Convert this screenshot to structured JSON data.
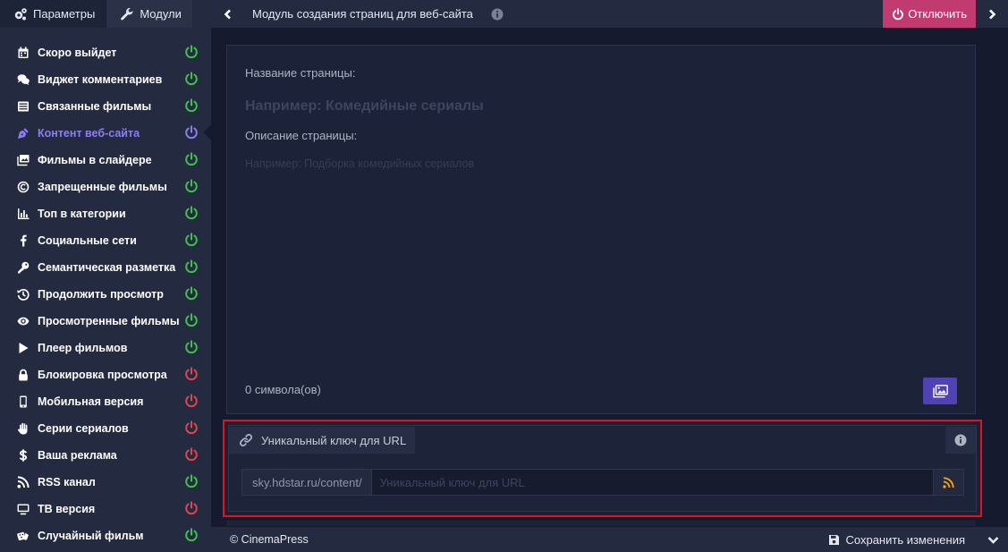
{
  "sidebar": {
    "tabs": [
      {
        "label": "Параметры",
        "icon": "gears-icon"
      },
      {
        "label": "Модули",
        "icon": "wrench-icon"
      }
    ],
    "items": [
      {
        "label": "Скоро выйдет",
        "icon": "calendar-icon",
        "status": "on"
      },
      {
        "label": "Виджет комментариев",
        "icon": "comments-icon",
        "status": "on"
      },
      {
        "label": "Связанные фильмы",
        "icon": "list-icon",
        "status": "on"
      },
      {
        "label": "Контент веб-сайта",
        "icon": "pen-nib-icon",
        "status": "active"
      },
      {
        "label": "Фильмы в слайдере",
        "icon": "images-icon",
        "status": "on"
      },
      {
        "label": "Запрещенные фильмы",
        "icon": "copyright-icon",
        "status": "on"
      },
      {
        "label": "Топ в категории",
        "icon": "chart-bar-icon",
        "status": "on"
      },
      {
        "label": "Социальные сети",
        "icon": "facebook-icon",
        "status": "on"
      },
      {
        "label": "Семантическая разметка",
        "icon": "key-icon",
        "status": "on"
      },
      {
        "label": "Продолжить просмотр",
        "icon": "history-icon",
        "status": "on"
      },
      {
        "label": "Просмотренные фильмы",
        "icon": "eye-icon",
        "status": "on"
      },
      {
        "label": "Плеер фильмов",
        "icon": "play-icon",
        "status": "on"
      },
      {
        "label": "Блокировка просмотра",
        "icon": "lock-icon",
        "status": "off"
      },
      {
        "label": "Мобильная версия",
        "icon": "mobile-icon",
        "status": "off"
      },
      {
        "label": "Серии сериалов",
        "icon": "hand-icon",
        "status": "off"
      },
      {
        "label": "Ваша реклама",
        "icon": "dollar-icon",
        "status": "off"
      },
      {
        "label": "RSS канал",
        "icon": "rss-icon",
        "status": "on"
      },
      {
        "label": "ТВ версия",
        "icon": "tv-icon",
        "status": "off"
      },
      {
        "label": "Случайный фильм",
        "icon": "dice-icon",
        "status": "on"
      }
    ]
  },
  "topbar": {
    "title": "Модуль создания страниц для веб-сайта",
    "disable_label": "Отключить"
  },
  "editor": {
    "title_label": "Название страницы:",
    "title_placeholder": "Например: Комедийные сериалы",
    "desc_label": "Описание страницы:",
    "desc_placeholder": "Например: Подборка комедийных сериалов",
    "char_count": "0 символа(ов)"
  },
  "url_key": {
    "label": "Уникальный ключ для URL",
    "prefix": "sky.hdstar.ru/content/",
    "placeholder": "Уникальный ключ для URL"
  },
  "footer": {
    "copyright": "© CinemaPress",
    "save_label": "Сохранить изменения"
  },
  "colors": {
    "on": "#3fc04a",
    "off": "#e0454f",
    "active": "#8f7cf2",
    "disable_button": "#c23b70",
    "highlight_border": "#e0141e",
    "gallery_button": "#5142b3",
    "rss": "#f0a020"
  }
}
